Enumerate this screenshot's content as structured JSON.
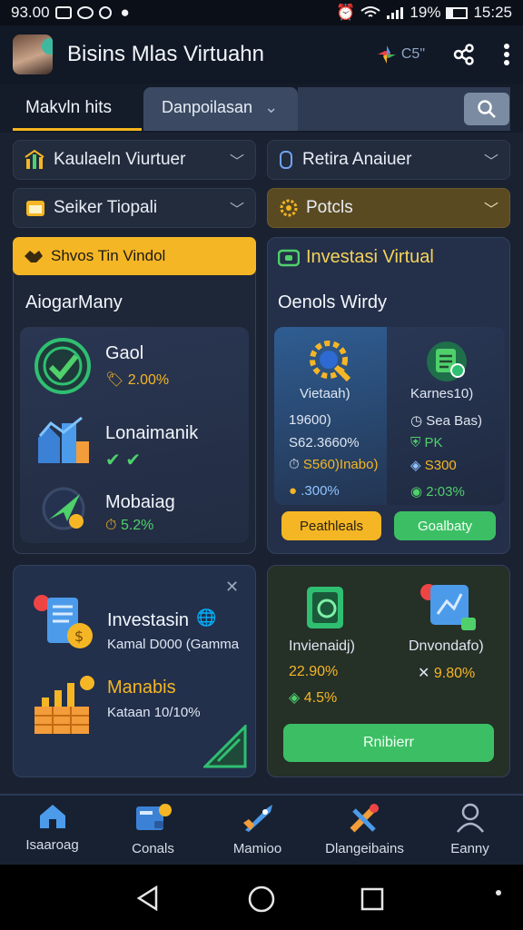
{
  "status": {
    "time_left": "93.00",
    "battery": "19%",
    "time_right": "15:25"
  },
  "header": {
    "title": "Bisins Mlas Virtuahn",
    "badge": "C5\""
  },
  "tabs": [
    {
      "label": "Makvln hits"
    },
    {
      "label": "Danpoilasan"
    }
  ],
  "filters": [
    {
      "label": "Kaulaeln Viurtuer"
    },
    {
      "label": "Retira Anaiuer"
    },
    {
      "label": "Seiker Tiopali"
    },
    {
      "label": "Potcls"
    }
  ],
  "left_card": {
    "banner": "Shvos Tin Vindol",
    "heading": "AiogarMany",
    "items": [
      {
        "title": "Gaol",
        "value": "2.00%"
      },
      {
        "title": "Lonaimanik",
        "value": ""
      },
      {
        "title": "Mobaiag",
        "value": "5.2%"
      }
    ]
  },
  "right_card": {
    "title": "Investasi Virtual",
    "heading": "Oenols Wirdy",
    "col1": {
      "label": "Vietaah)",
      "line1": "19600)",
      "line2": "S62.3660%",
      "line3": "S560)Inabo)",
      "line4": ".300%"
    },
    "col2": {
      "label": "Karnes10)",
      "line1": "Sea Bas)",
      "line2": "PK",
      "line3": "S300",
      "line4": "2:03%"
    },
    "btn_yellow": "Peathleals",
    "btn_green": "Goalbaty"
  },
  "bottom_left": {
    "row1_title": "Investasin",
    "row1_sub": "Kamal D000 (Gamma",
    "row2_title": "Manabis",
    "row2_sub": "Kataan 10/10%"
  },
  "bottom_right": {
    "col1_label": "Invienaidj)",
    "col1_v1": "22.90%",
    "col1_v2": "4.5%",
    "col2_label": "Dnvondafo)",
    "col2_v1": "9.80%",
    "button": "Rnibierr"
  },
  "nav": [
    {
      "label": "Isaaroag",
      "icon": "home-icon"
    },
    {
      "label": "Conals",
      "icon": "wallet-icon"
    },
    {
      "label": "Mamioo",
      "icon": "rocket-icon"
    },
    {
      "label": "Dlangeibains",
      "icon": "tools-icon"
    },
    {
      "label": "Eanny",
      "icon": "user-icon"
    }
  ],
  "colors": {
    "accent": "#f5b625",
    "positive": "#4fd06b",
    "background": "#1a2232"
  }
}
